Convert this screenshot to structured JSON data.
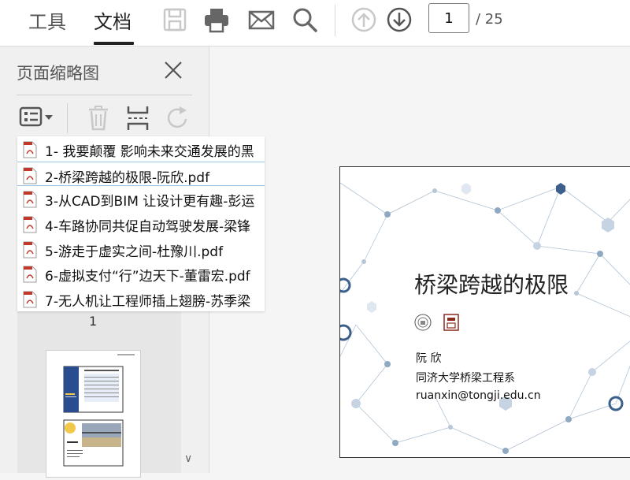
{
  "toolbar": {
    "tabs": [
      {
        "label": "工具"
      },
      {
        "label": "文档"
      }
    ],
    "page_current": "1",
    "page_total": "/ 25"
  },
  "sidebar": {
    "title": "页面缩略图",
    "thumb_page_label": "1"
  },
  "attachments": [
    {
      "name": "1- 我要颠覆 影响未来交通发展的黑"
    },
    {
      "name": "2-桥梁跨越的极限-阮欣.pdf"
    },
    {
      "name": "3-从CAD到BIM 让设计更有趣-彭运"
    },
    {
      "name": "4-车路协同共促自动驾驶发展-梁锋"
    },
    {
      "name": "5-游走于虚实之间-杜豫川.pdf"
    },
    {
      "name": "6-虚拟支付“行”边天下-董雷宏.pdf"
    },
    {
      "name": "7-无人机让工程师插上翅膀-苏季梁"
    }
  ],
  "slide": {
    "title": "桥梁跨越的极限",
    "author": "阮 欣",
    "affiliation": "同济大学桥梁工程系",
    "email": "ruanxin@tongji.edu.cn"
  },
  "colors": {
    "accent": "#2f5597",
    "node": "#8ea9c1",
    "pdf_red": "#c0392b"
  }
}
